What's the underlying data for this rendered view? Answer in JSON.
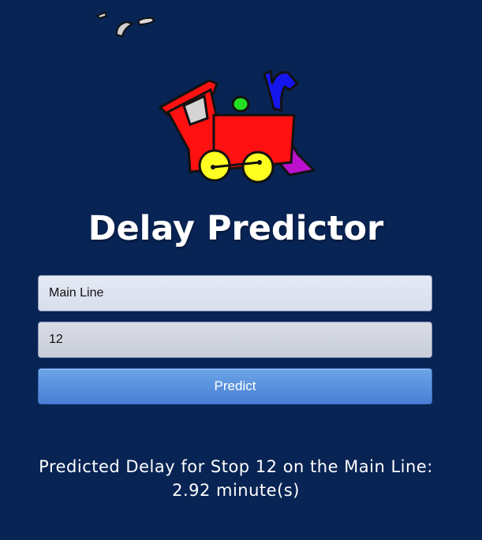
{
  "page": {
    "title": "Delay Predictor",
    "background_color": "#082454"
  },
  "graphic": {
    "icon": "train-icon"
  },
  "form": {
    "line_value": "Main Line",
    "stop_value": "12",
    "predict_label": "Predict"
  },
  "result": {
    "text": "Predicted Delay for Stop 12 on the Main Line: 2.92 minute(s)"
  }
}
